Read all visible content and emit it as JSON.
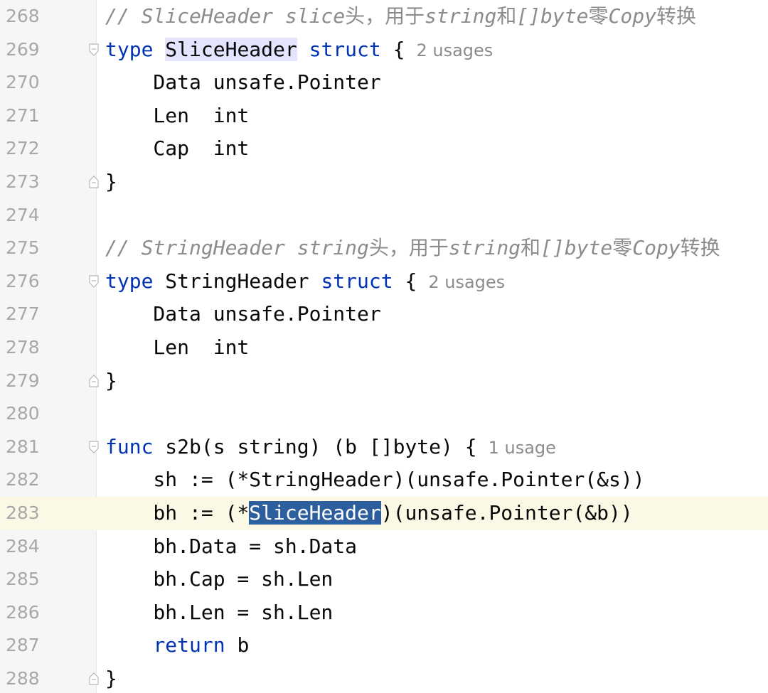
{
  "editor": {
    "usage_one": "1 usage",
    "usage_two": "2 usages",
    "lines": [
      {
        "n": "268",
        "comment_a": "// SliceHeader slice",
        "comment_b": "头，用于",
        "comment_c": "string",
        "comment_d": "和",
        "comment_e": "[]byte",
        "comment_f": "零",
        "comment_g": "Copy",
        "comment_h": "转换"
      },
      {
        "n": "269",
        "kw1": "type",
        "name": "SliceHeader",
        "kw2": "struct",
        "tail": " {"
      },
      {
        "n": "270",
        "text": "    Data unsafe.Pointer"
      },
      {
        "n": "271",
        "text": "    Len  int"
      },
      {
        "n": "272",
        "text": "    Cap  int"
      },
      {
        "n": "273",
        "text": "}"
      },
      {
        "n": "274",
        "text": ""
      },
      {
        "n": "275",
        "comment_a": "// StringHeader string",
        "comment_b": "头，用于",
        "comment_c": "string",
        "comment_d": "和",
        "comment_e": "[]byte",
        "comment_f": "零",
        "comment_g": "Copy",
        "comment_h": "转换"
      },
      {
        "n": "276",
        "kw1": "type",
        "name": "StringHeader",
        "kw2": "struct",
        "tail": " {"
      },
      {
        "n": "277",
        "text": "    Data unsafe.Pointer"
      },
      {
        "n": "278",
        "text": "    Len  int"
      },
      {
        "n": "279",
        "text": "}"
      },
      {
        "n": "280",
        "text": ""
      },
      {
        "n": "281",
        "kw1": "func",
        "rest": " s2b(s string) (b []byte) {"
      },
      {
        "n": "282",
        "text": "    sh := (*StringHeader)(unsafe.Pointer(&s))"
      },
      {
        "n": "283",
        "pre": "    bh := (*",
        "sel": "SliceHeader",
        "post": ")(unsafe.Pointer(&b))"
      },
      {
        "n": "284",
        "text": "    bh.Data = sh.Data"
      },
      {
        "n": "285",
        "text": "    bh.Cap = sh.Len"
      },
      {
        "n": "286",
        "text": "    bh.Len = sh.Len"
      },
      {
        "n": "287",
        "indent": "    ",
        "kw1": "return",
        "rest": " b"
      },
      {
        "n": "288",
        "text": "}"
      }
    ]
  }
}
